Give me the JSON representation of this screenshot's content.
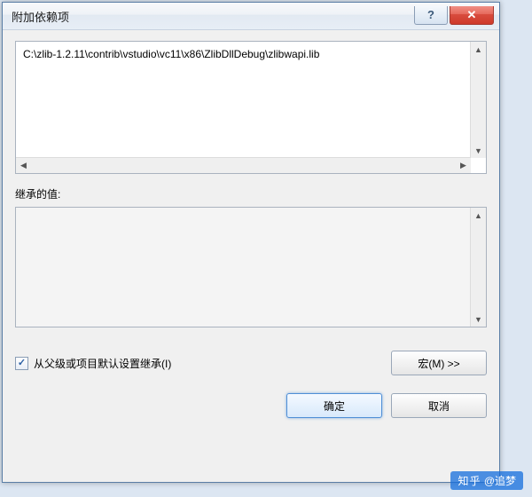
{
  "dialog": {
    "title": "附加依赖项",
    "top_value": "C:\\zlib-1.2.11\\contrib\\vstudio\\vc11\\x86\\ZlibDllDebug\\zlibwapi.lib",
    "inherited_label": "继承的值:",
    "inherited_value": "",
    "inherit_checkbox_label": "从父级或项目默认设置继承(I)",
    "inherit_checked": true,
    "macro_button": "宏(M) >>",
    "ok_button": "确定",
    "cancel_button": "取消"
  },
  "watermark": {
    "brand": "知乎",
    "user": "@追梦"
  }
}
